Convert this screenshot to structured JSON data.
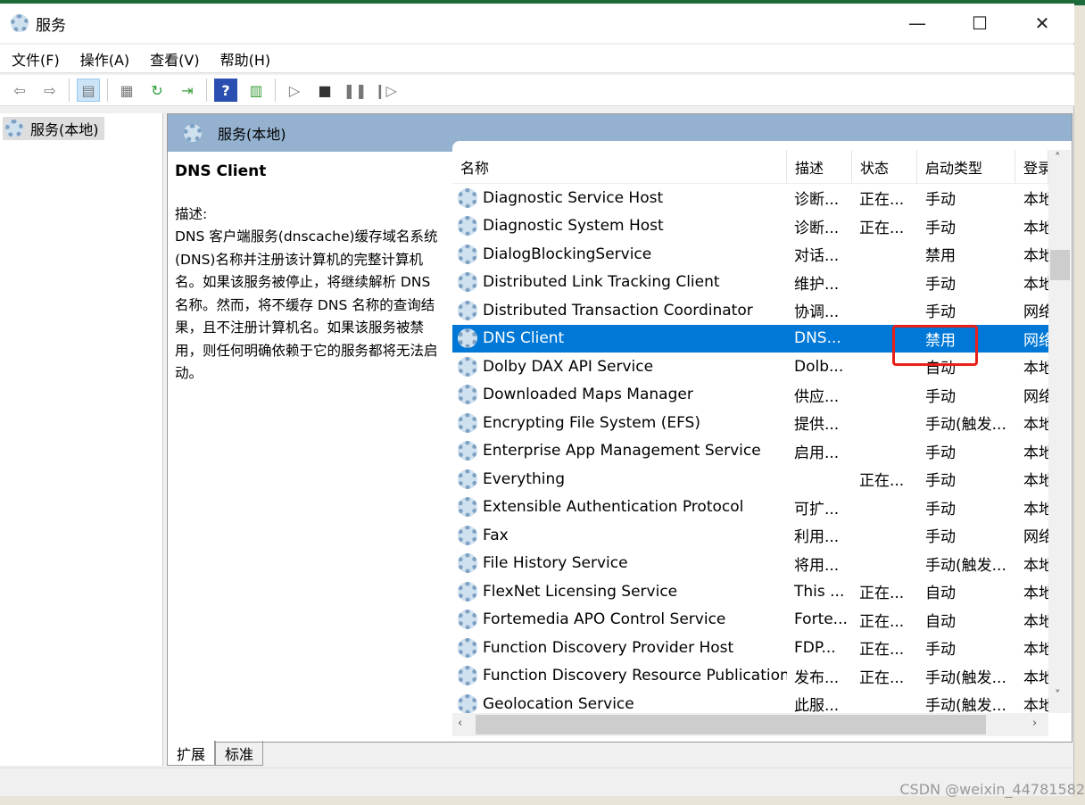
{
  "window": {
    "title": "服务",
    "minimize": "—",
    "maximize": "☐",
    "close": "✕"
  },
  "menu": [
    "文件(F)",
    "操作(A)",
    "查看(V)",
    "帮助(H)"
  ],
  "toolbar": [
    "back-icon",
    "forward-icon",
    "show-hide-console-tree-icon",
    "properties-icon",
    "refresh-icon",
    "export-list-icon",
    "help-icon",
    "show-action-pane-icon",
    "start-icon",
    "stop-icon",
    "pause-icon",
    "restart-icon"
  ],
  "tree": {
    "item": "服务(本地)"
  },
  "panel": {
    "title": "服务(本地)"
  },
  "description": {
    "service": "DNS Client",
    "label": "描述:",
    "text": "DNS 客户端服务(dnscache)缓存域名系统(DNS)名称并注册该计算机的完整计算机名。如果该服务被停止，将继续解析 DNS 名称。然而，将不缓存 DNS 名称的查询结果，且不注册计算机名。如果该服务被禁用，则任何明确依赖于它的服务都将无法启动。"
  },
  "columns": [
    "名称",
    "描述",
    "状态",
    "启动类型",
    "登录"
  ],
  "rows": [
    [
      "Diagnostic Service Host",
      "诊断...",
      "正在...",
      "手动",
      "本地"
    ],
    [
      "Diagnostic System Host",
      "诊断...",
      "正在...",
      "手动",
      "本地"
    ],
    [
      "DialogBlockingService",
      "对话...",
      "",
      "禁用",
      "本地"
    ],
    [
      "Distributed Link Tracking Client",
      "维护...",
      "",
      "手动",
      "本地"
    ],
    [
      "Distributed Transaction Coordinator",
      "协调...",
      "",
      "手动",
      "网络"
    ],
    [
      "DNS Client",
      "DNS...",
      "",
      "禁用",
      "网络"
    ],
    [
      "Dolby DAX API Service",
      "Dolb...",
      "",
      "自动",
      "本地"
    ],
    [
      "Downloaded Maps Manager",
      "供应...",
      "",
      "手动",
      "网络"
    ],
    [
      "Encrypting File System (EFS)",
      "提供...",
      "",
      "手动(触发...",
      "本地"
    ],
    [
      "Enterprise App Management Service",
      "启用...",
      "",
      "手动",
      "本地"
    ],
    [
      "Everything",
      "",
      "正在...",
      "手动",
      "本地"
    ],
    [
      "Extensible Authentication Protocol",
      "可扩...",
      "",
      "手动",
      "本地"
    ],
    [
      "Fax",
      "利用...",
      "",
      "手动",
      "网络"
    ],
    [
      "File History Service",
      "将用...",
      "",
      "手动(触发...",
      "本地"
    ],
    [
      "FlexNet Licensing Service",
      "This ...",
      "正在...",
      "自动",
      "本地"
    ],
    [
      "Fortemedia APO Control Service",
      "Forte...",
      "正在...",
      "自动",
      "本地"
    ],
    [
      "Function Discovery Provider Host",
      "FDP...",
      "正在...",
      "手动",
      "本地"
    ],
    [
      "Function Discovery Resource Publication",
      "发布...",
      "正在...",
      "手动(触发...",
      "本地"
    ],
    [
      "Geolocation Service",
      "此服...",
      "",
      "手动(触发...",
      "本地"
    ]
  ],
  "selected_row": "DNS Client",
  "tabs": [
    "扩展",
    "标准"
  ],
  "watermark": "CSDN @weixin_44781582",
  "colors": {
    "selection": "#0078d7",
    "header": "#94b1cf",
    "highlight_box": "#e8201a"
  }
}
